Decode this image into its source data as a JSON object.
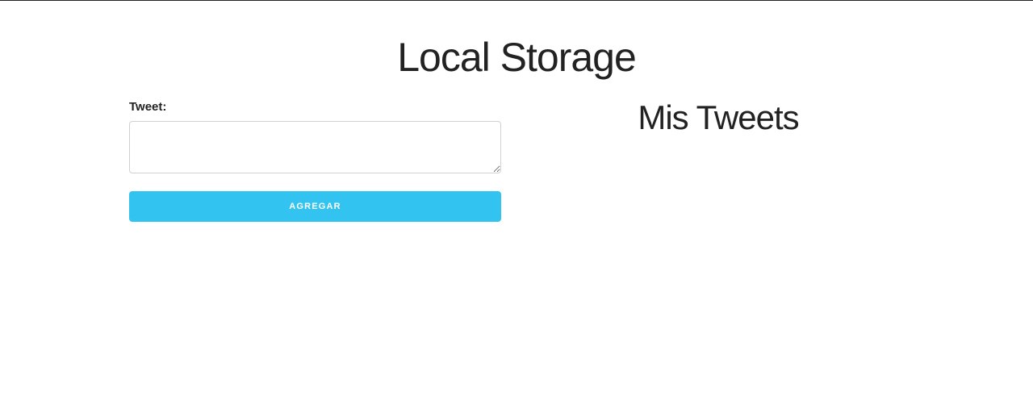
{
  "page": {
    "title": "Local Storage"
  },
  "form": {
    "label": "Tweet:",
    "textarea_value": "",
    "textarea_placeholder": "",
    "submit_label": "AGREGAR"
  },
  "tweets": {
    "heading": "Mis Tweets",
    "items": []
  },
  "colors": {
    "accent": "#33c3f0",
    "text": "#222222",
    "border": "#d1d1d1",
    "background": "#ffffff"
  }
}
